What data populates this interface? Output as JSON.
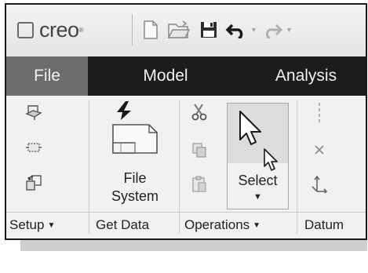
{
  "app": {
    "logo_text": "creo",
    "logo_mark": "®"
  },
  "quick_access": [
    {
      "icon": "new-file-icon"
    },
    {
      "icon": "open-folder-icon"
    },
    {
      "icon": "save-icon"
    },
    {
      "icon": "undo-icon"
    },
    {
      "icon": "redo-icon"
    }
  ],
  "tabs": [
    {
      "label": "File",
      "active": true
    },
    {
      "label": "Model",
      "active": false
    },
    {
      "label": "Analysis",
      "active": false
    }
  ],
  "groups": {
    "setup": {
      "label": "Setup",
      "dropdown": "▼"
    },
    "get_data": {
      "label": "Get Data"
    },
    "operations": {
      "label": "Operations",
      "dropdown": "▼"
    },
    "datum": {
      "label": "Datum"
    }
  },
  "buttons": {
    "file_system": {
      "line1": "File",
      "line2": "System"
    },
    "select": {
      "label": "Select",
      "arrow": "▼"
    }
  },
  "colors": {
    "tab_bar": "#1c1c1c",
    "active_tab": "#6c6c6c",
    "accent_arrow": "#1a1a1a"
  }
}
